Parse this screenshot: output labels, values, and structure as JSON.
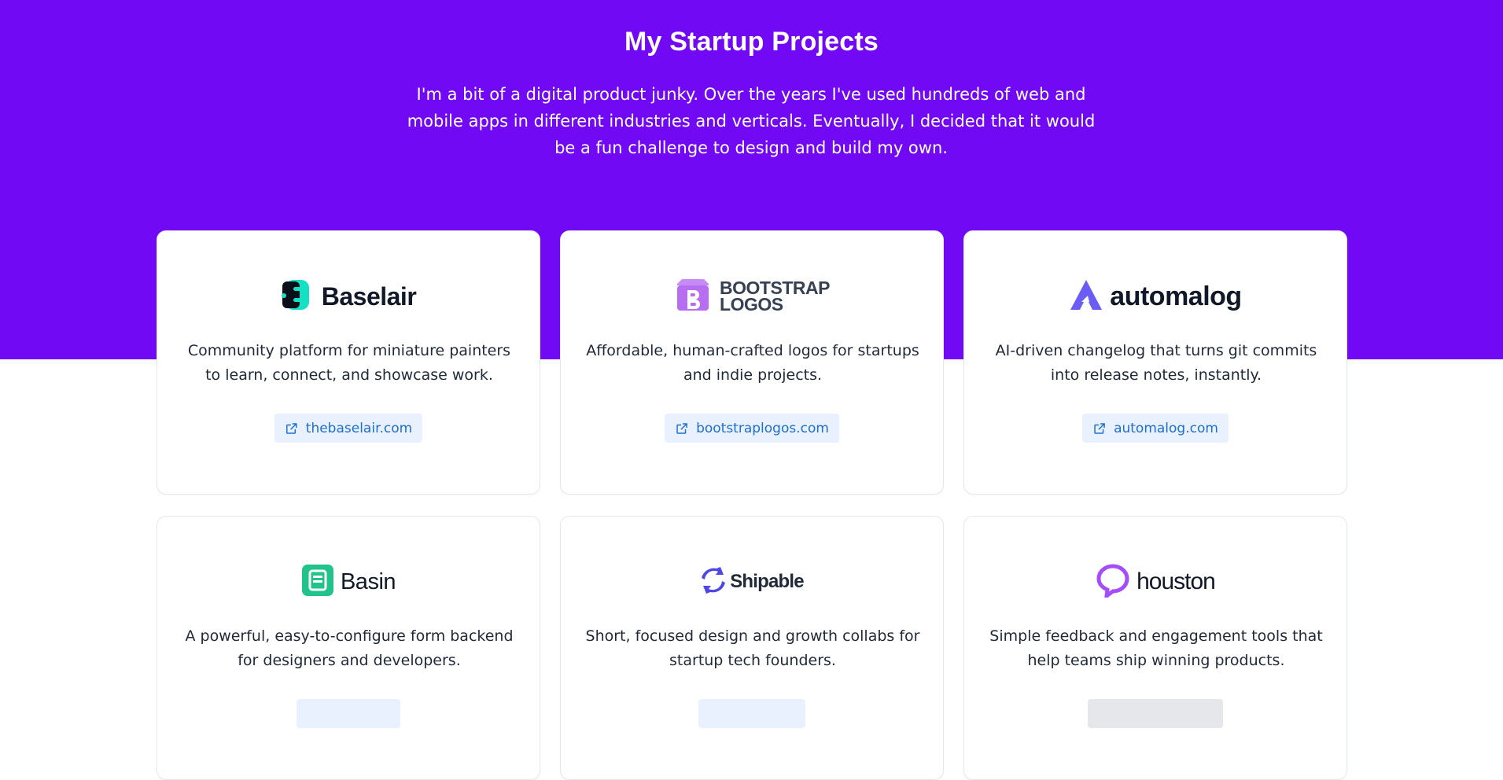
{
  "header": {
    "title": "My Startup Projects",
    "intro": "I'm a bit of a digital product junky. Over the years I've used hundreds of web and mobile apps in different industries and verticals. Eventually, I decided that it would be a fun challenge to design and build my own."
  },
  "projects": [
    {
      "name": "Baselair",
      "description": "Community platform for miniature painters to learn, connect, and showcase work.",
      "link": "thebaselair.com",
      "icon": "baselair-logo-icon"
    },
    {
      "name_line1": "BOOTSTRAP",
      "name_line2": "LOGOS",
      "description": "Affordable, human-crafted logos for startups and indie projects.",
      "link": "bootstraplogos.com",
      "icon": "bootstrap-logos-logo-icon"
    },
    {
      "name": "automalog",
      "description": "AI-driven changelog that turns git commits into release notes, instantly.",
      "link": "automalog.com",
      "icon": "automalog-logo-icon"
    },
    {
      "name": "Basin",
      "description": "A powerful, easy-to-configure form backend for designers and developers.",
      "icon": "basin-logo-icon"
    },
    {
      "name": "Shipable",
      "description": "Short, focused design and growth collabs for startup tech founders.",
      "icon": "shipable-logo-icon"
    },
    {
      "name": "houston",
      "description": "Simple feedback and engagement tools that help teams ship winning products.",
      "icon": "houston-logo-icon"
    }
  ],
  "colors": {
    "hero_background": "#7209f4",
    "link_background": "#e8f1fd",
    "link_text": "#1f6fd1",
    "baselair_accent": "#14e0c4",
    "bootstrap_purple": "#b76ef0",
    "automalog_purple": "#6b5cf6",
    "basin_green": "#22c38a",
    "shipable_blue": "#4f46e5",
    "houston_purple": "#a44dfa"
  }
}
